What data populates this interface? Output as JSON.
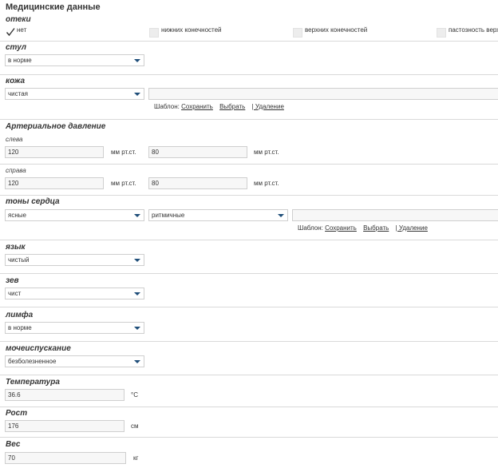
{
  "title": "Медицинские данные",
  "edema": {
    "label": "отеки",
    "options": [
      "нет",
      "нижних конечностей",
      "верхних конечностей",
      "пастозность верх"
    ]
  },
  "stool": {
    "label": "стул",
    "value": "в норме"
  },
  "skin": {
    "label": "кожа",
    "value": "чистая",
    "text": ""
  },
  "template": {
    "label": "Шаблон:",
    "save": "Сохранить",
    "choose": "Выбрать",
    "delete": "| Удаление"
  },
  "bp": {
    "title": "Артериальное давление",
    "left_label": "слева",
    "right_label": "справа",
    "unit": "мм рт.ст.",
    "left_sys": "120",
    "left_dia": "80",
    "right_sys": "120",
    "right_dia": "80"
  },
  "heart": {
    "label": "тоны сердца",
    "tone": "ясные",
    "rhythm": "ритмичные",
    "text": ""
  },
  "tongue": {
    "label": "язык",
    "value": "чистый"
  },
  "throat": {
    "label": "зев",
    "value": "чист"
  },
  "lymph": {
    "label": "лимфа",
    "value": "в норме"
  },
  "urination": {
    "label": "мочеиспускание",
    "value": "безболезненное"
  },
  "temperature": {
    "label": "Температура",
    "value": "36.6",
    "unit": "°C"
  },
  "height": {
    "label": "Рост",
    "value": "176",
    "unit": "см"
  },
  "weight": {
    "label": "Вес",
    "value": "70",
    "unit": "кг"
  }
}
